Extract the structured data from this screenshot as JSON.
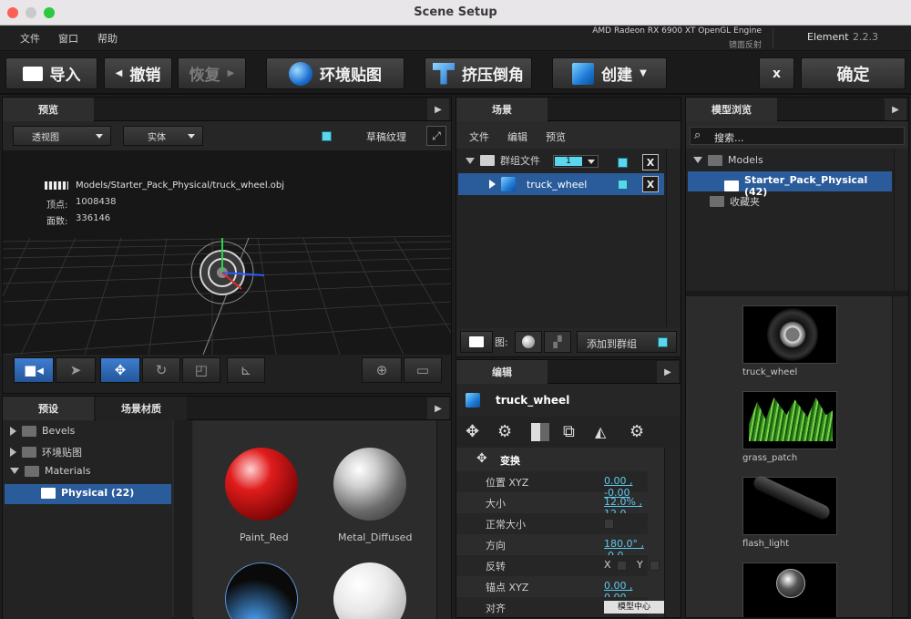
{
  "window": {
    "title": "Scene Setup"
  },
  "menu": {
    "items": [
      "文件",
      "窗口",
      "帮助"
    ],
    "engine": "AMD Radeon RX 6900 XT OpenGL Engine",
    "engine_sub": "镜面反射",
    "product": "Element",
    "version": "2.2.3"
  },
  "toolbar": {
    "import": "导入",
    "undo": "撤销",
    "redo": "恢复",
    "env_map": "环境贴图",
    "extrude": "挤压倒角",
    "create": "创建",
    "close": "x",
    "ok": "确定"
  },
  "preview": {
    "tab": "预览",
    "view_mode": "透视图",
    "render_mode": "实体",
    "draft_texture": "草稿纹理",
    "file_path": "Models/Starter_Pack_Physical/truck_wheel.obj",
    "vertices_label": "顶点:",
    "vertices": "1008438",
    "faces_label": "面数:",
    "faces": "336146"
  },
  "scene": {
    "tab": "场景",
    "menu": [
      "文件",
      "编辑",
      "预览"
    ],
    "group_label": "群组文件",
    "group_value": "1",
    "item": "truck_wheel",
    "x": "X",
    "bottom_label": "图:",
    "add_group": "添加到群组"
  },
  "browser": {
    "tab": "模型浏览",
    "search_placeholder": "搜索...",
    "tree": [
      "Models",
      "Starter_Pack_Physical (42)",
      "收藏夹"
    ],
    "thumbs": [
      "truck_wheel",
      "grass_patch",
      "flash_light",
      ""
    ]
  },
  "presets": {
    "tabs": [
      "预设",
      "场景材质"
    ],
    "tree": [
      "Bevels",
      "环境贴图",
      "Materials",
      "Physical (22)"
    ],
    "materials": [
      "Paint_Red",
      "Metal_Diffused",
      "",
      ""
    ]
  },
  "edit": {
    "tab": "编辑",
    "object": "truck_wheel",
    "section": "变换",
    "rows": [
      {
        "key": "位置 XYZ",
        "value": "0.00 ,  -0.00"
      },
      {
        "key": "大小",
        "value": "12.0% ,  12.0"
      },
      {
        "key": "正常大小",
        "value": ""
      },
      {
        "key": "方向",
        "value": "180.0° ,  -0.0"
      },
      {
        "key": "反转",
        "value": ""
      },
      {
        "key": "锚点 XYZ",
        "value": "0.00 ,  0.00 ,"
      },
      {
        "key": "对齐",
        "value": "模型中心"
      }
    ],
    "flip_x": "X",
    "flip_y": "Y"
  },
  "colors": {
    "accent": "#5ad7ee",
    "selection": "#2a5b9a",
    "value_link": "#5ec9ec"
  }
}
